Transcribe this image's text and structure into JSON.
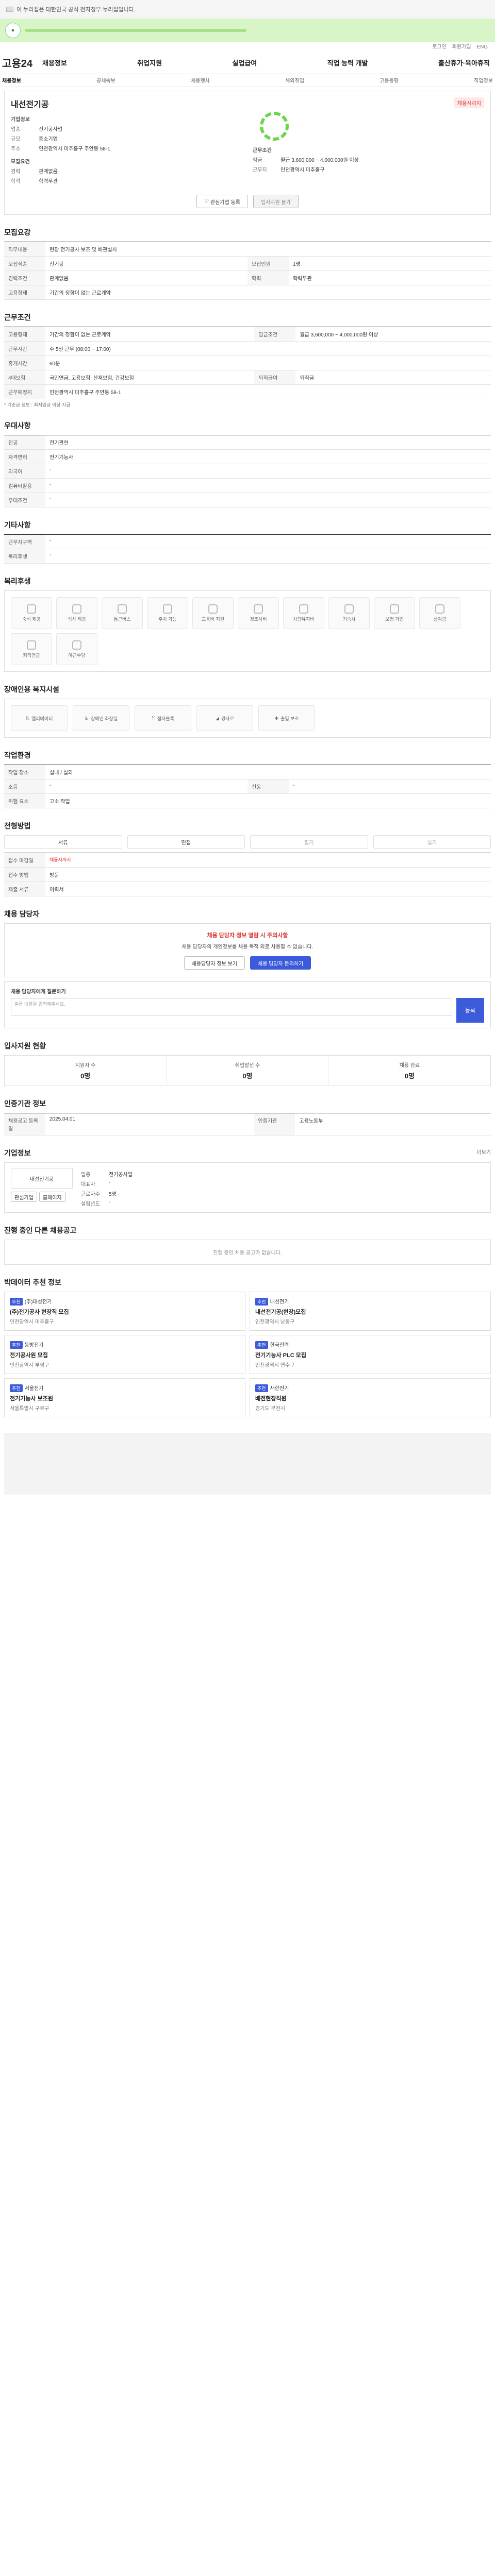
{
  "top": {
    "gov_notice": "이 누리집은 대한민국 공식 전자정부 누리집입니다."
  },
  "util": {
    "items": [
      "로그인",
      "회원가입",
      "ENG"
    ]
  },
  "header": {
    "logo": "고용24",
    "gnb": [
      "채용정보",
      "취업지원",
      "실업급여",
      "직업 능력 개발",
      "출산휴가·육아휴직"
    ]
  },
  "subnav": {
    "items": [
      "채용정보",
      "공채속보",
      "채용행사",
      "해외취업",
      "고용동향",
      "직업정보"
    ],
    "active": 0
  },
  "company": {
    "name": "내선전기공",
    "tag": "채용시까지",
    "info_title": "기업정보",
    "rows": [
      {
        "k": "업종",
        "v": "전기공사업"
      },
      {
        "k": "규모",
        "v": "중소기업"
      },
      {
        "k": "주소",
        "v": "인천광역시 미추홀구 주안동 58-1"
      }
    ],
    "req_title": "모집요건",
    "req_rows": [
      {
        "k": "경력",
        "v": "관계없음"
      },
      {
        "k": "학력",
        "v": "학력무관"
      }
    ],
    "cond_title": "근무조건",
    "cond_rows": [
      {
        "k": "임금",
        "v": "월급 3,600,000 ~ 4,000,000원 이상"
      },
      {
        "k": "근무지",
        "v": "인천광역시 미추홀구"
      }
    ],
    "btn_interest": "관심기업 등록",
    "btn_apply": "입사지원 불가"
  },
  "recruit": {
    "title": "모집요강",
    "rows": [
      {
        "k": "직무내용",
        "v": "현장 전기공사 보조 및 배관설치"
      },
      {
        "k": "모집직종",
        "v": "전기공"
      },
      {
        "k": "모집인원",
        "v": "1명"
      },
      {
        "k": "경력조건",
        "v": "관계없음"
      },
      {
        "k": "학력",
        "v": "학력무관"
      },
      {
        "k": "고용형태",
        "v": "기간의 정함이 없는 근로계약"
      }
    ]
  },
  "work": {
    "title": "근무조건",
    "rows": [
      {
        "k": "고용형태",
        "v": "기간의 정함이 없는 근로계약"
      },
      {
        "k": "임금조건",
        "v": "월급 3,600,000 ~ 4,000,000원 이상"
      },
      {
        "k": "근무시간",
        "v": "주 5일 근무 (08:00 ~ 17:00)"
      },
      {
        "k": "휴게시간",
        "v": "60분"
      },
      {
        "k": "4대보험",
        "v": "국민연금, 고용보험, 산재보험, 건강보험"
      },
      {
        "k": "퇴직급여",
        "v": "퇴직금"
      },
      {
        "k": "근무예정지",
        "v": "인천광역시 미추홀구 주안동 58-1"
      }
    ],
    "note": "* 기준금 정보 : 최저임금 이상 지급"
  },
  "prefer": {
    "title": "우대사항",
    "rows": [
      {
        "k": "전공",
        "v": "전기관련"
      },
      {
        "k": "자격면허",
        "v": "전기기능사"
      },
      {
        "k": "외국어",
        "v": "-"
      },
      {
        "k": "컴퓨터활용",
        "v": "-"
      },
      {
        "k": "우대조건",
        "v": "-"
      }
    ]
  },
  "etc": {
    "title": "기타사항",
    "rows": [
      {
        "k": "근무지구역",
        "v": "-"
      },
      {
        "k": "복리후생",
        "v": "-"
      }
    ]
  },
  "welfare": {
    "title": "복리후생",
    "items": [
      "숙식 제공",
      "식사 제공",
      "통근버스",
      "주차 가능",
      "교육비 지원",
      "경조사비",
      "차량유지비",
      "기숙사",
      "보험 가입",
      "상여금",
      "퇴직연금",
      "야근수당"
    ]
  },
  "disability": {
    "title": "장애인용 복지시설",
    "items": [
      "엘리베이터",
      "장애인 화장실",
      "점자블록",
      "경사로",
      "출입 보조"
    ]
  },
  "workplace": {
    "title": "작업환경",
    "rows": [
      {
        "k": "작업 장소",
        "v": "실내 / 실외"
      },
      {
        "k": "소음",
        "v": "-"
      },
      {
        "k": "진동",
        "v": "-"
      },
      {
        "k": "위험 요소",
        "v": "고소 작업"
      }
    ]
  },
  "selection": {
    "title": "전형방법",
    "methods": [
      {
        "label": "서류",
        "on": true
      },
      {
        "label": "면접",
        "on": true
      },
      {
        "label": "필기",
        "on": false
      },
      {
        "label": "실기",
        "on": false
      }
    ],
    "rows": [
      {
        "k": "접수 마감일",
        "v": "채용시까지"
      },
      {
        "k": "접수 방법",
        "v": "방문"
      },
      {
        "k": "제출 서류",
        "v": "이력서"
      }
    ]
  },
  "contact": {
    "title": "채용 담당자",
    "notice_head": "채용 담당자 정보 열람 시 주의사항",
    "notice_text": "채용 담당자의 개인정보를 채용 목적 외로 사용할 수 없습니다.",
    "btn_view": "채용담당자 정보 보기",
    "btn_inquiry": "채용 담당자 문의하기",
    "inquiry_title": "채용 담당자에게 질문하기",
    "inquiry_placeholder": "질문 내용을 입력해주세요.",
    "submit": "등록"
  },
  "applicants": {
    "title": "입사지원 현황",
    "stats": [
      {
        "label": "지원자 수",
        "value": "0명"
      },
      {
        "label": "취업알선 수",
        "value": "0명"
      },
      {
        "label": "채용 완료",
        "value": "0명"
      }
    ]
  },
  "info": {
    "title": "인증기관 정보",
    "rows": [
      {
        "k": "채용공고 등록일",
        "v": "2025.04.01"
      },
      {
        "k": "인증기관",
        "v": "고용노동부"
      }
    ]
  },
  "company_info": {
    "title": "기업정보",
    "more": "더보기",
    "name": "내선전기공",
    "rows": [
      {
        "k": "업종",
        "v": "전기공사업"
      },
      {
        "k": "대표자",
        "v": "-"
      },
      {
        "k": "근로자수",
        "v": "5명"
      },
      {
        "k": "설립년도",
        "v": "-"
      }
    ],
    "btn1": "관심기업",
    "btn2": "홈페이지"
  },
  "other_jobs": {
    "title": "진행 중인 다른 채용공고",
    "empty": "진행 중인 채용 공고가 없습니다."
  },
  "recommend": {
    "title": "박데이터 추천 정보",
    "items": [
      {
        "badge": "추천",
        "company": "(주)대성전기",
        "title": "(주)전기공사 현장직 모집",
        "sub": "인천광역시 미추홀구"
      },
      {
        "badge": "추천",
        "company": "내선전기",
        "title": "내선전기공(현장)모집",
        "sub": "인천광역시 남동구"
      },
      {
        "badge": "추천",
        "company": "동방전기",
        "title": "전기공사원 모집",
        "sub": "인천광역시 부평구"
      },
      {
        "badge": "추천",
        "company": "한국전력",
        "title": "전기기능사 PLC 모집",
        "sub": "인천광역시 연수구"
      },
      {
        "badge": "추천",
        "company": "서울전기",
        "title": "전기기능사 보조원",
        "sub": "서울특별시 구로구"
      },
      {
        "badge": "추천",
        "company": "새한전기",
        "title": "배전현장직원",
        "sub": "경기도 부천시"
      }
    ]
  }
}
